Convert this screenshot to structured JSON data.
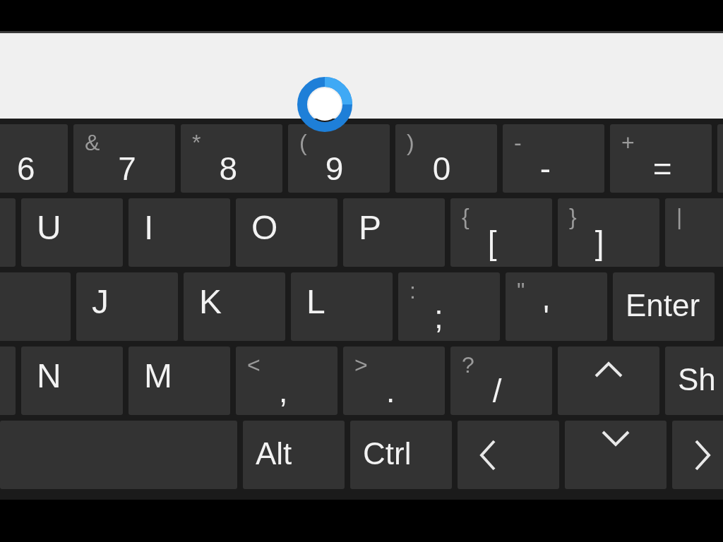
{
  "keyboard": {
    "rows": [
      {
        "keys": [
          {
            "kind": "char",
            "primary": "6"
          },
          {
            "kind": "char",
            "secondary": "&",
            "primary": "7"
          },
          {
            "kind": "char",
            "secondary": "*",
            "primary": "8"
          },
          {
            "kind": "char",
            "secondary": "(",
            "primary": "9"
          },
          {
            "kind": "char",
            "secondary": ")",
            "primary": "0"
          },
          {
            "kind": "char",
            "secondary": "-",
            "primary": "-"
          },
          {
            "kind": "char",
            "secondary": "+",
            "primary": "="
          },
          {
            "kind": "blank"
          }
        ]
      },
      {
        "keys": [
          {
            "kind": "blank"
          },
          {
            "kind": "letter",
            "primary": "U"
          },
          {
            "kind": "letter",
            "primary": "I"
          },
          {
            "kind": "letter",
            "primary": "O"
          },
          {
            "kind": "letter",
            "primary": "P"
          },
          {
            "kind": "char",
            "secondary": "{",
            "primary": "["
          },
          {
            "kind": "char",
            "secondary": "}",
            "primary": "]"
          },
          {
            "kind": "char",
            "secondary": "|"
          }
        ]
      },
      {
        "keys": [
          {
            "kind": "blank"
          },
          {
            "kind": "letter",
            "primary": "J"
          },
          {
            "kind": "letter",
            "primary": "K"
          },
          {
            "kind": "letter",
            "primary": "L"
          },
          {
            "kind": "char",
            "secondary": ":",
            "primary": ";"
          },
          {
            "kind": "char",
            "secondary": "\"",
            "primary": "'"
          },
          {
            "kind": "word",
            "primary": "Enter"
          }
        ]
      },
      {
        "keys": [
          {
            "kind": "blank"
          },
          {
            "kind": "letter",
            "primary": "N"
          },
          {
            "kind": "letter",
            "primary": "M"
          },
          {
            "kind": "char",
            "secondary": "<",
            "primary": ","
          },
          {
            "kind": "char",
            "secondary": ">",
            "primary": "."
          },
          {
            "kind": "char",
            "secondary": "?",
            "primary": "/"
          },
          {
            "kind": "up"
          },
          {
            "kind": "word",
            "primary": "Sh"
          }
        ]
      },
      {
        "keys": [
          {
            "kind": "space"
          },
          {
            "kind": "word",
            "primary": "Alt"
          },
          {
            "kind": "word",
            "primary": "Ctrl"
          },
          {
            "kind": "left"
          },
          {
            "kind": "down"
          },
          {
            "kind": "right"
          }
        ]
      }
    ]
  }
}
